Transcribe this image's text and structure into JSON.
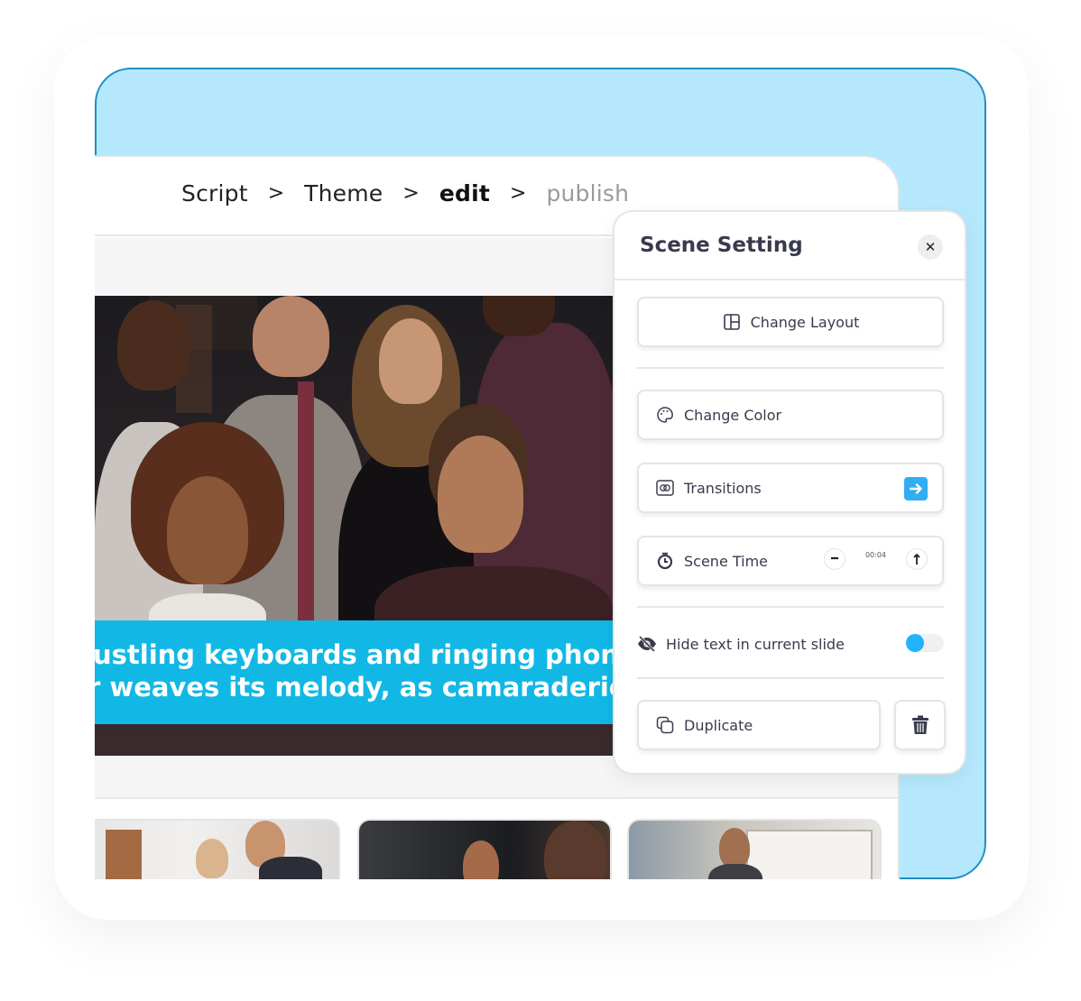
{
  "breadcrumb": {
    "steps": [
      {
        "label": "Script",
        "state": "done"
      },
      {
        "label": "Theme",
        "state": "done"
      },
      {
        "label": "edit",
        "state": "active"
      },
      {
        "label": "publish",
        "state": "disabled"
      }
    ],
    "separator": ">"
  },
  "slide": {
    "image": "group-of-business-professionals-photo",
    "caption_lines": [
      "ustling keyboards and ringing phones,",
      "r weaves its melody, as camaraderie"
    ],
    "caption_bg": "#12b8e5"
  },
  "thumbnails": [
    {
      "image": "two-colleagues-laughing-office-photo"
    },
    {
      "image": "smiling-woman-meeting-photo"
    },
    {
      "image": "man-in-front-of-modern-building-photo"
    }
  ],
  "panel": {
    "title": "Scene Setting",
    "close_icon": "close-icon",
    "change_layout": {
      "label": "Change Layout",
      "icon": "layout-icon"
    },
    "change_color": {
      "label": "Change Color",
      "icon": "palette-icon"
    },
    "transitions": {
      "label": "Transitions",
      "icon": "transition-icon",
      "action_icon": "arrow-right-icon"
    },
    "scene_time": {
      "label": "Scene Time",
      "icon": "stopwatch-icon",
      "value": "00:04",
      "decrement_icon": "minus-icon",
      "increment_icon": "arrow-up-icon"
    },
    "hide_text": {
      "label": "Hide text in current slide",
      "icon": "eye-slash-icon",
      "enabled": false
    },
    "duplicate": {
      "label": "Duplicate",
      "icon": "copy-icon"
    },
    "delete": {
      "icon": "trash-icon"
    }
  },
  "colors": {
    "accent": "#32aef0",
    "toggle_knob": "#21b3fb",
    "background_card": "#b5e8fd",
    "background_card_border": "#1e8fc4"
  }
}
